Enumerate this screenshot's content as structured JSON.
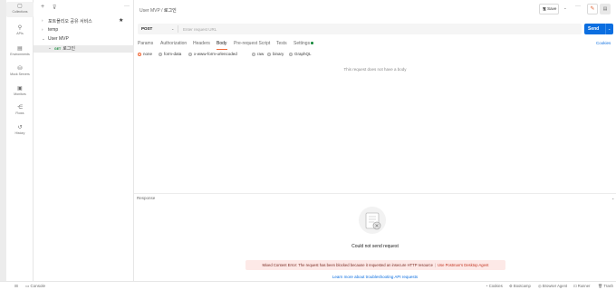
{
  "rail": {
    "items": [
      {
        "label": "Collections",
        "icon": "collections-icon"
      },
      {
        "label": "APIs",
        "icon": "apis-icon"
      },
      {
        "label": "Environments",
        "icon": "environments-icon"
      },
      {
        "label": "Mock Servers",
        "icon": "mock-servers-icon"
      },
      {
        "label": "Monitors",
        "icon": "monitors-icon"
      },
      {
        "label": "Flows",
        "icon": "flows-icon"
      },
      {
        "label": "History",
        "icon": "history-icon"
      }
    ]
  },
  "sidebar": {
    "tree": [
      {
        "chev": "›",
        "label": "포트폴리오 공유 서비스"
      },
      {
        "chev": "›",
        "label": "temp"
      },
      {
        "chev": "⌄",
        "label": "User MVP"
      },
      {
        "chev": "⌄",
        "method": "GET",
        "label": "로그인"
      }
    ]
  },
  "header": {
    "crumb_parent": "User MVP",
    "crumb_sep": " / ",
    "crumb_current": "로그인",
    "save_label": "Save",
    "save_icon": "save-icon"
  },
  "request": {
    "method": "POST",
    "url_value": "",
    "url_placeholder": "Enter request URL",
    "send_label": "Send",
    "tabs": [
      "Params",
      "Authorization",
      "Headers",
      "Body",
      "Pre-request Script",
      "Tests",
      "Settings"
    ],
    "active_tab": "Body",
    "cookies_label": "Cookies",
    "body_options": [
      "none",
      "form-data",
      "x-www-form-urlencoded",
      "raw",
      "binary",
      "GraphQL"
    ],
    "selected_body_option": "none",
    "no_body_message": "This request does not have a body"
  },
  "response": {
    "label": "Response",
    "error_title": "Could not send request",
    "error_message": "Mixed Content Error: The request has been blocked because it requested an insecure HTTP resource",
    "error_link": "Use Postman's Desktop Agent",
    "learn_more": "Learn more about troubleshooting API requests"
  },
  "statusbar": {
    "console_label": "Console",
    "right_items": [
      "Cookies",
      "Bootcamp",
      "Browser Agent",
      "Runner",
      "Trash"
    ]
  },
  "colors": {
    "accent_orange": "#f26b3a",
    "send_blue": "#0b6ee0",
    "method_green": "#1b8b3f",
    "error_bg": "#fde9e7"
  }
}
